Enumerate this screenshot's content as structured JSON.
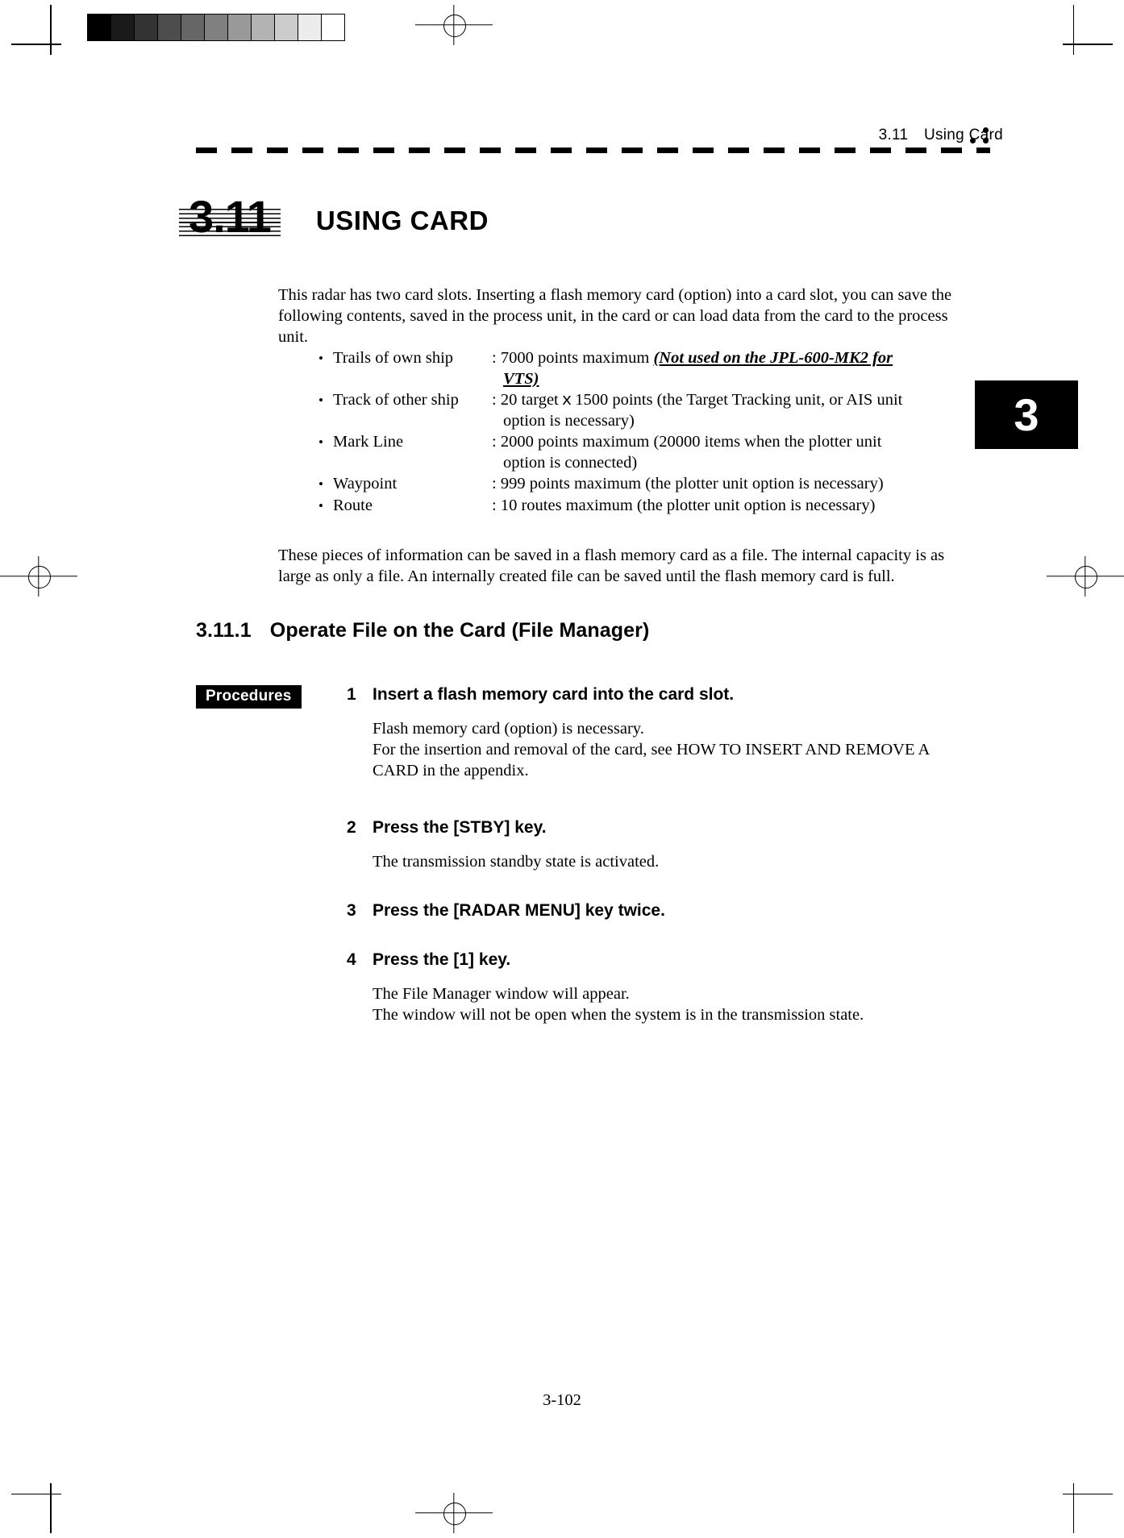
{
  "printers_marks": {
    "grayscale_steps": [
      "#000000",
      "#1a1a1a",
      "#333333",
      "#4d4d4d",
      "#666666",
      "#808080",
      "#999999",
      "#b3b3b3",
      "#cccccc",
      "#ececec",
      "#ffffff"
    ],
    "registration_icon": "registration-crosshair-icon",
    "crop_icon": "crop-mark-icon"
  },
  "running_header": {
    "number": "3.11",
    "title": "Using Card"
  },
  "chapter_tab": {
    "label": "3"
  },
  "section": {
    "number": "3.11",
    "title": "USING CARD"
  },
  "intro_paragraph": "This radar has two card slots.    Inserting a flash memory card (option) into a card slot, you can save the following contents, saved in the process unit, in the card or can load data from the card to the process unit.",
  "spec_list": {
    "bullet_glyph": "•",
    "items": [
      {
        "term": "Trails of own ship",
        "definition": ": 7000 points maximum ",
        "emphasis": "(Not used on the JPL-600-MK2 for",
        "emphasis_cont": " VTS)",
        "continuation": ""
      },
      {
        "term": "Track of other ship",
        "definition": ": 20 targetｘ1500 points (the Target Tracking unit, or AIS unit",
        "continuation": "option is  necessary)"
      },
      {
        "term": "Mark Line",
        "definition": ": 2000 points maximum (20000 items when the plotter unit",
        "continuation": "option is connected)"
      },
      {
        "term": "Waypoint",
        "definition": ": 999 points maximum (the plotter unit option is necessary)",
        "continuation": ""
      },
      {
        "term": "Route",
        "definition": ": 10 routes maximum (the plotter unit option is necessary)",
        "continuation": ""
      }
    ]
  },
  "outro_paragraph": "These pieces of information can be saved in a flash memory card as a file.    The internal capacity is as large as only a file.    An internally created file can be saved until the flash memory card is full.",
  "subsection": {
    "number": "3.11.1",
    "title": "Operate File on the Card (File Manager)"
  },
  "procedures_badge": "Procedures",
  "steps": [
    {
      "number": "1",
      "title": "Insert a flash memory card into the card slot.",
      "body_line1": "Flash memory card (option) is necessary.",
      "body_line2": "For the insertion and removal of the card, see HOW TO INSERT AND REMOVE A CARD in the appendix."
    },
    {
      "number": "2",
      "title": "Press the [STBY] key.",
      "body_line1": "The transmission standby state is activated.",
      "body_line2": ""
    },
    {
      "number": "3",
      "title": "Press the [RADAR MENU] key twice.",
      "body_line1": "",
      "body_line2": ""
    },
    {
      "number": "4",
      "title": "Press the [1] key.",
      "body_line1": "The File Manager window will appear.",
      "body_line2": "The window will not be open when the system is in the transmission state."
    }
  ],
  "folio": "3-102"
}
